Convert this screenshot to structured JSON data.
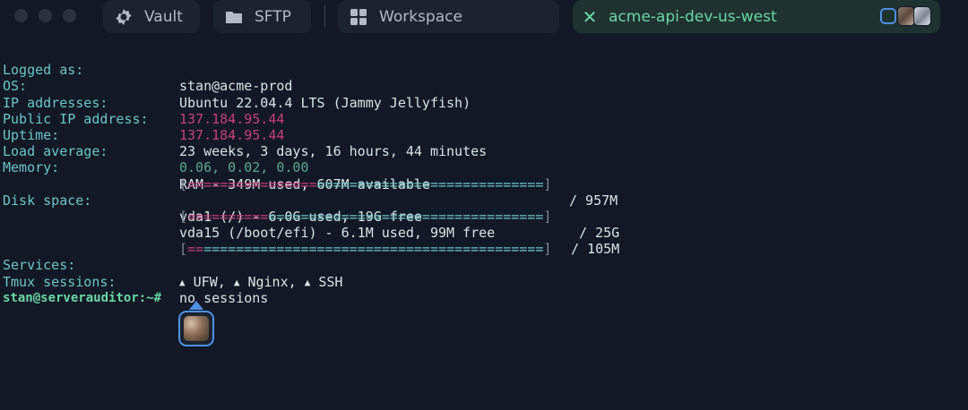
{
  "tabs": {
    "vault": {
      "label": "Vault",
      "icon": "vault-icon"
    },
    "sftp": {
      "label": "SFTP",
      "icon": "folder-icon"
    },
    "workspace": {
      "label": "Workspace",
      "icon": "grid-icon"
    },
    "active": {
      "label": "acme-api-dev-us-west",
      "close_icon": "close-icon",
      "accent": "#69d7a6"
    }
  },
  "terminal": {
    "logged_as": {
      "key": "Logged as:",
      "value": "stan@acme-prod"
    },
    "os": {
      "key": "OS:",
      "value": "Ubuntu 22.04.4 LTS (Jammy Jellyfish)"
    },
    "ip": {
      "key": "IP addresses:",
      "value": "137.184.95.44"
    },
    "public_ip": {
      "key": "Public IP address:",
      "value": "137.184.95.44"
    },
    "uptime": {
      "key": "Uptime:",
      "value": "23 weeks, 3 days, 16 hours, 44 minutes"
    },
    "load": {
      "key": "Load average:",
      "value": "0.06, 0.02, 0.00"
    },
    "memory": {
      "key": "Memory:",
      "value": "RAM - 349M used, 607M available",
      "total": "/ 957M",
      "bar": {
        "open": "[",
        "used": "================",
        "free": "============================",
        "close": "]"
      }
    },
    "disk": {
      "key": "Disk space:",
      "vda1": {
        "value": "vda1 (/) - 6.0G used, 19G free",
        "total": "/ 25G",
        "bar": {
          "open": "[",
          "used": "==========",
          "free": "==================================",
          "close": "]"
        }
      },
      "vda15": {
        "value": "vda15 (/boot/efi) - 6.1M used, 99M free",
        "total": "/ 105M",
        "bar": {
          "open": "[",
          "used": "==",
          "free": "==========================================",
          "close": "]"
        }
      }
    },
    "services": {
      "key": "Services:",
      "items": [
        {
          "icon": "▲",
          "name": "UFW"
        },
        {
          "icon": "▲",
          "name": "Nginx"
        },
        {
          "icon": "▲",
          "name": "SSH"
        }
      ]
    },
    "tmux": {
      "key": "Tmux sessions:",
      "value": "no sessions"
    },
    "prompt": "stan@serverauditor:~#"
  },
  "colors": {
    "background": "#121826",
    "key_cyan": "#6bc6c8",
    "value_pink": "#c8407a",
    "green": "#69d7a6",
    "collab_blue": "#4f91e3"
  }
}
